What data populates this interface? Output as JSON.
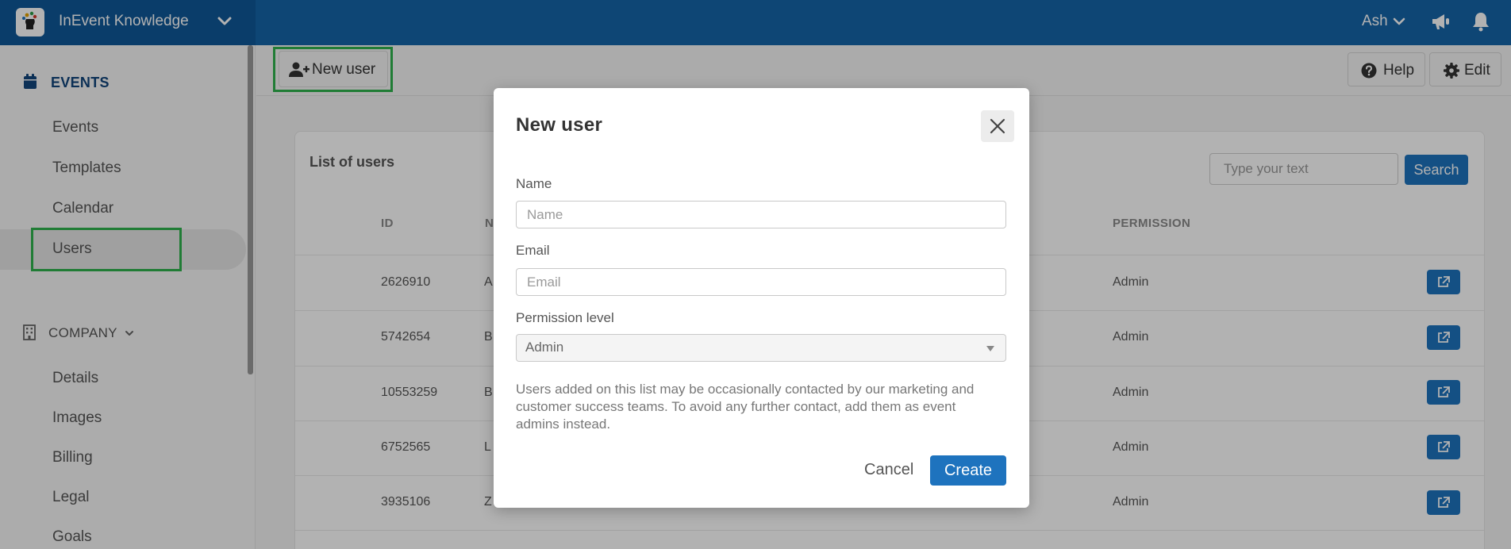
{
  "header": {
    "app_name": "InEvent Knowledge",
    "user_name": "Ash"
  },
  "sidebar": {
    "events_section": "EVENTS",
    "events_items": [
      {
        "label": "Events"
      },
      {
        "label": "Templates"
      },
      {
        "label": "Calendar"
      },
      {
        "label": "Users",
        "active": true
      }
    ],
    "company_section": "COMPANY",
    "company_items": [
      {
        "label": "Details"
      },
      {
        "label": "Images"
      },
      {
        "label": "Billing"
      },
      {
        "label": "Legal"
      },
      {
        "label": "Goals"
      }
    ]
  },
  "toolbar": {
    "new_user_label": "New user",
    "help_label": "Help",
    "edit_label": "Edit"
  },
  "users_list": {
    "title": "List of users",
    "search_placeholder": "Type your text",
    "search_button": "Search",
    "columns": [
      "ID",
      "N",
      "PERMISSION"
    ],
    "rows": [
      {
        "id": "2626910",
        "name": "A",
        "permission": "Admin"
      },
      {
        "id": "5742654",
        "name": "B",
        "permission": "Admin"
      },
      {
        "id": "10553259",
        "name": "B",
        "permission": "Admin"
      },
      {
        "id": "6752565",
        "name": "L",
        "permission": "Admin"
      },
      {
        "id": "3935106",
        "name": "Z",
        "permission": "Admin"
      }
    ]
  },
  "modal": {
    "title": "New user",
    "name_label": "Name",
    "name_placeholder": "Name",
    "email_label": "Email",
    "email_placeholder": "Email",
    "permission_label": "Permission level",
    "permission_value": "Admin",
    "note": "Users added on this list may be occasionally contacted by our marketing and customer success teams. To avoid any further contact, add them as event admins instead.",
    "cancel_label": "Cancel",
    "create_label": "Create"
  },
  "colors": {
    "topbar": "#1565a8",
    "brand_bg": "#0f5898",
    "accent_blue": "#1e73be",
    "highlight_green": "#2fb24c",
    "section_title": "#12467c"
  }
}
